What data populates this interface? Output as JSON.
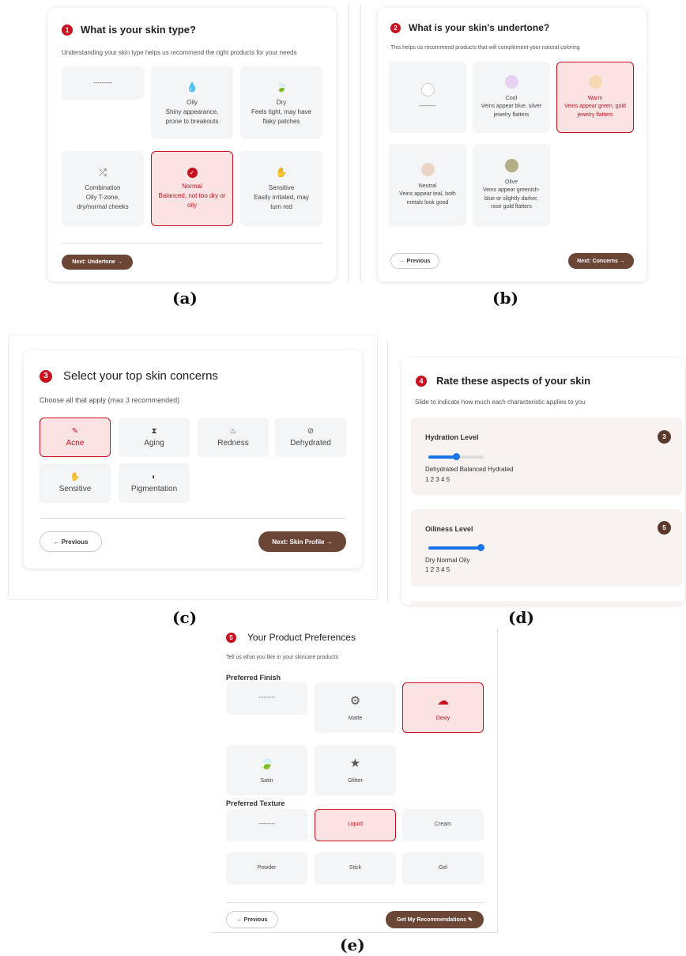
{
  "captions": {
    "a": "(a)",
    "b": "(b)",
    "c": "(c)",
    "d": "(d)",
    "e": "(e)"
  },
  "colors": {
    "accent": "#c8101e",
    "brown": "#6b4535",
    "selected_bg": "#fbe3e4",
    "option_bg": "#f4f5f7",
    "slider_blue": "#1a73e8"
  },
  "panel_a": {
    "step": "1",
    "title": "What is your skin type?",
    "subtitle": "Understanding your skin type helps us recommend the right products for your needs",
    "options": [
      {
        "icon": "",
        "title": "---------",
        "desc": ""
      },
      {
        "icon": "water-drop-icon",
        "title": "Oily",
        "desc": "Shiny appearance, prone to breakouts"
      },
      {
        "icon": "leaf-icon",
        "title": "Dry",
        "desc": "Feels tight, may have flaky patches"
      },
      {
        "icon": "shuffle-icon",
        "title": "Combination",
        "desc": "Oily T-zone, dry/normal cheeks"
      },
      {
        "icon": "check-circle-icon",
        "title": "Normal",
        "desc": "Balanced, not too dry or oily",
        "selected": true
      },
      {
        "icon": "hand-icon",
        "title": "Sensitive",
        "desc": "Easily irritated, may turn red"
      }
    ],
    "next_label": "Next: Undertone →"
  },
  "panel_b": {
    "step": "2",
    "title": "What is your skin's undertone?",
    "subtitle": "This helps us recommend products that will complement your natural coloring",
    "options": [
      {
        "swatch": "#ffffff",
        "title": "---------",
        "desc": ""
      },
      {
        "swatch": "#e6d2f0",
        "title": "Cool",
        "desc": "Veins appear blue, silver jewelry flatters"
      },
      {
        "swatch": "#f5d9b3",
        "title": "Warm",
        "desc": "Veins appear green, gold jewelry flatters",
        "selected": true
      },
      {
        "swatch": "#ecd5c6",
        "title": "Neutral",
        "desc": "Veins appear teal, both metals look good"
      },
      {
        "swatch": "#b3ae88",
        "title": "Olive",
        "desc": "Veins appear greenish-blue or slightly darker, rose gold flatters"
      }
    ],
    "prev_label": "← Previous",
    "next_label": "Next: Concerns →"
  },
  "panel_c": {
    "step": "3",
    "title": "Select your top skin concerns",
    "subtitle": "Choose all that apply (max 3 recommended)",
    "options": [
      {
        "icon": "bandage-icon",
        "label": "Acne",
        "selected": true
      },
      {
        "icon": "hourglass-icon",
        "label": "Aging"
      },
      {
        "icon": "fire-icon",
        "label": "Redness"
      },
      {
        "icon": "no-drop-icon",
        "label": "Dehydrated"
      },
      {
        "icon": "hand-icon",
        "label": "Sensitive"
      },
      {
        "icon": "half-circle-icon",
        "label": "Pigmentation"
      }
    ],
    "prev_label": "← Previous",
    "next_label": "Next: Skin Profile →"
  },
  "panel_d": {
    "step": "4",
    "title": "Rate these aspects of your skin",
    "subtitle": "Slide to indicate how much each characteristic applies to you",
    "sliders": [
      {
        "label": "Hydration Level",
        "value": "3",
        "fraction": 0.5,
        "scale_text": "Dehydrated Balanced Hydrated",
        "numbers": "1 2 3 4 5"
      },
      {
        "label": "Oiliness Level",
        "value": "5",
        "fraction": 1.0,
        "scale_text": "Dry Normal Oily",
        "numbers": "1 2 3 4 5"
      }
    ]
  },
  "panel_e": {
    "step": "5",
    "title": "Your Product Preferences",
    "subtitle": "Tell us what you like in your skincare products",
    "finish_heading": "Preferred Finish",
    "finish": [
      {
        "icon": "",
        "label": "---------"
      },
      {
        "icon": "gear-icon",
        "label": "Matte"
      },
      {
        "icon": "cloud-icon",
        "label": "Dewy",
        "selected": true
      },
      {
        "icon": "leaf-icon",
        "label": "Satin"
      },
      {
        "icon": "star-icon",
        "label": "Glitter"
      }
    ],
    "texture_heading": "Preferred Texture",
    "texture": [
      {
        "label": "---------"
      },
      {
        "label": "Liquid",
        "selected": true
      },
      {
        "label": "Cream"
      },
      {
        "label": "Powder"
      },
      {
        "label": "Stick"
      },
      {
        "label": "Gel"
      }
    ],
    "prev_label": "← Previous",
    "submit_label": "Get My Recommendations ✎"
  }
}
